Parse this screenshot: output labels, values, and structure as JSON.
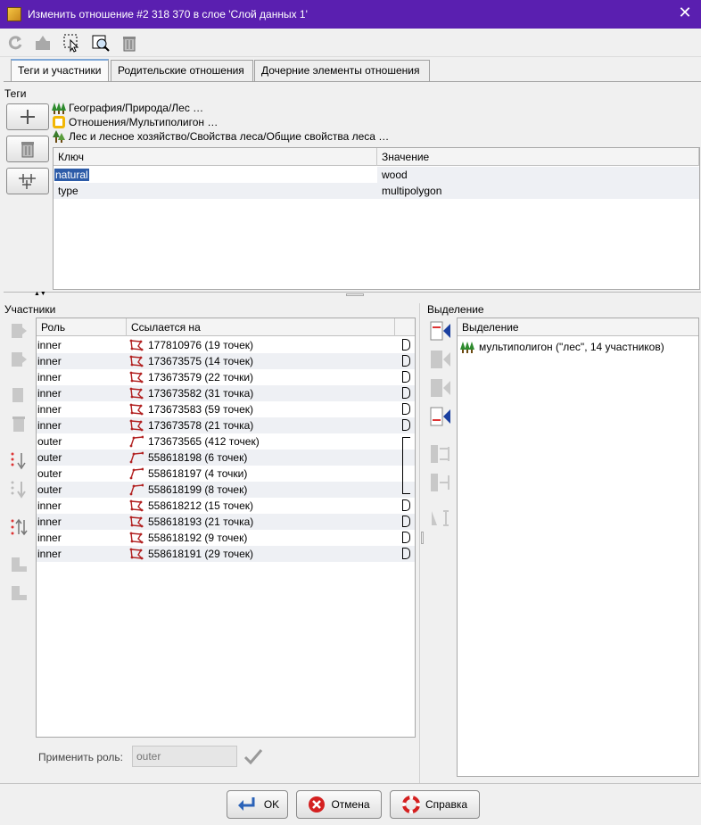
{
  "window": {
    "title": "Изменить отношение #2 318 370 в слое 'Слой данных 1'",
    "close_label": "✕"
  },
  "toolbar": {
    "buttons": [
      "refresh-icon",
      "upload-icon",
      "select-icon",
      "zoom-to-icon",
      "delete-icon"
    ]
  },
  "tabs": [
    {
      "label": "Теги и участники",
      "active": true
    },
    {
      "label": "Родительские отношения",
      "active": false
    },
    {
      "label": "Дочерние элементы отношения",
      "active": false
    }
  ],
  "tags_section": {
    "label": "Теги",
    "presets": [
      {
        "label": "География/Природа/Лес …",
        "icon": "forest-icon"
      },
      {
        "label": "Отношения/Мультиполигон …",
        "icon": "multipolygon-icon"
      },
      {
        "label": "Лес и лесное хозяйство/Свойства леса/Общие свойства леса …",
        "icon": "tree-icon"
      }
    ],
    "columns": [
      "Ключ",
      "Значение"
    ],
    "rows": [
      {
        "key": "natural",
        "value": "wood",
        "selected": true
      },
      {
        "key": "type",
        "value": "multipolygon",
        "selected": false
      }
    ]
  },
  "members_section": {
    "label": "Участники",
    "columns": [
      "Роль",
      "Ссылается на"
    ],
    "rows": [
      {
        "role": "inner",
        "ref": "177810976 (19 точек)",
        "link": "closed"
      },
      {
        "role": "inner",
        "ref": "173673575 (14 точек)",
        "link": "closed"
      },
      {
        "role": "inner",
        "ref": "173673579 (22 точки)",
        "link": "closed"
      },
      {
        "role": "inner",
        "ref": "173673582 (31 точка)",
        "link": "closed"
      },
      {
        "role": "inner",
        "ref": "173673583 (59 точек)",
        "link": "closed"
      },
      {
        "role": "inner",
        "ref": "173673578 (21 точка)",
        "link": "closed"
      },
      {
        "role": "outer",
        "ref": "173673565 (412 точек)",
        "link": "start"
      },
      {
        "role": "outer",
        "ref": "558618198 (6 точек)",
        "link": "mid"
      },
      {
        "role": "outer",
        "ref": "558618197 (4 точки)",
        "link": "mid"
      },
      {
        "role": "outer",
        "ref": "558618199 (8 точек)",
        "link": "end"
      },
      {
        "role": "inner",
        "ref": "558618212 (15 точек)",
        "link": "closed"
      },
      {
        "role": "inner",
        "ref": "558618193 (21 точка)",
        "link": "closed"
      },
      {
        "role": "inner",
        "ref": "558618192 (9 точек)",
        "link": "closed"
      },
      {
        "role": "inner",
        "ref": "558618191 (29 точек)",
        "link": "closed"
      }
    ],
    "apply_role_label": "Применить роль:",
    "apply_role_placeholder": "outer"
  },
  "selection_section": {
    "label": "Выделение",
    "column": "Выделение",
    "items": [
      "мультиполигон (\"лес\", 14 участников)"
    ]
  },
  "buttons": {
    "ok": "OK",
    "cancel": "Отмена",
    "help": "Справка"
  }
}
